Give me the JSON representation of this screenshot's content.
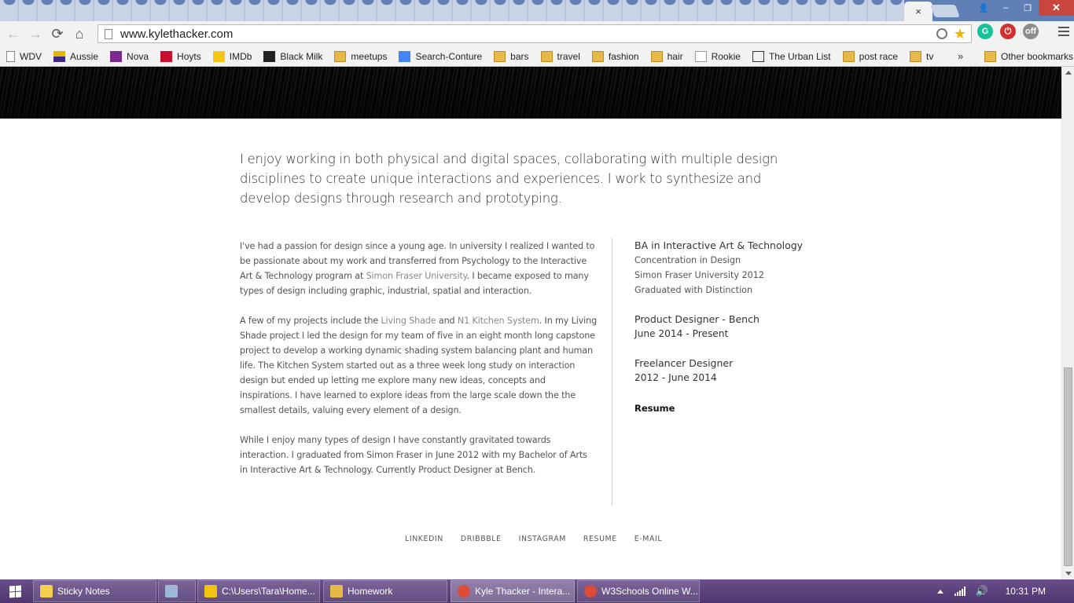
{
  "browser": {
    "active_tab_close": "×",
    "window_controls": {
      "user": "👤",
      "minimize": "–",
      "restore": "❐",
      "close": "✕"
    },
    "nav": {
      "back": "←",
      "forward": "→",
      "reload": "⟳",
      "home": "⌂"
    },
    "url": "www.kylethacker.com",
    "star": "★",
    "extensions": [
      {
        "name": "grammarly-icon",
        "label": "G",
        "color": "#15c39a"
      },
      {
        "name": "power-icon",
        "label": "⏻",
        "color": "#d32f2f"
      },
      {
        "name": "cat-extension-icon",
        "label": "off",
        "color": "#8c8c8c"
      }
    ]
  },
  "bookmarks": {
    "items": [
      {
        "label": "WDV",
        "icon": "doc"
      },
      {
        "label": "Aussie",
        "icon": "aussie"
      },
      {
        "label": "Nova",
        "icon": "nova"
      },
      {
        "label": "Hoyts",
        "icon": "hoyts"
      },
      {
        "label": "IMDb",
        "icon": "imdb"
      },
      {
        "label": "Black Milk",
        "icon": "bm"
      },
      {
        "label": "meetups",
        "icon": "folder"
      },
      {
        "label": "Search-Conture",
        "icon": "google"
      },
      {
        "label": "bars",
        "icon": "folder"
      },
      {
        "label": "travel",
        "icon": "folder"
      },
      {
        "label": "fashion",
        "icon": "folder"
      },
      {
        "label": "hair",
        "icon": "folder"
      },
      {
        "label": "Rookie",
        "icon": "rookie"
      },
      {
        "label": "The Urban List",
        "icon": "urban"
      },
      {
        "label": "post race",
        "icon": "folder"
      },
      {
        "label": "tv",
        "icon": "folder"
      }
    ],
    "overflow": "»",
    "other": "Other bookmarks"
  },
  "page": {
    "intro": "I enjoy working in both physical and digital spaces, collaborating with multiple design disciplines to create unique interactions and experiences. I work to synthesize and develop designs through research and prototyping.",
    "bio": {
      "p1_a": "I've had a passion for design since a young age. In university I realized I wanted to be passionate about my work and transferred from Psychology to the Interactive Art & Technology program at ",
      "p1_link": "Simon Fraser University",
      "p1_b": ". I became exposed to many types of design including graphic, industrial, spatial and interaction.",
      "p2_a": "A few of my projects include the ",
      "p2_link1": "Living Shade",
      "p2_and": " and ",
      "p2_link2": "N1 Kitchen System",
      "p2_b": ". In my Living Shade project I led the design for my team of five in an eight month long capstone project to develop a working dynamic shading system balancing plant and human life. The Kitchen System started out as a three week long study on interaction design but ended up letting me explore many new ideas, concepts and inspirations. I have learned to explore ideas from the large scale down the the smallest details, valuing every element of a design.",
      "p3": "While I enjoy many types of design I have constantly gravitated towards interaction. I graduated from Simon Fraser in June 2012 with my Bachelor of Arts in Interactive Art & Technology. Currently Product Designer at Bench."
    },
    "cv": {
      "degree_title": "BA in Interactive Art & Technology",
      "degree_lines": [
        "Concentration in Design",
        "Simon Fraser University 2012",
        "Graduated with Distinction"
      ],
      "job1_title": "Product Designer - Bench",
      "job1_dates": "June 2014 - Present",
      "job2_title": "Freelancer Designer",
      "job2_dates": "2012 - June 2014",
      "resume": "Resume"
    },
    "footer_links": [
      "LINKEDIN",
      "DRIBBBLE",
      "INSTAGRAM",
      "RESUME",
      "E-MAIL"
    ]
  },
  "taskbar": {
    "items": [
      {
        "label": "Sticky Notes",
        "color": "#f5d04c"
      },
      {
        "label": "",
        "color": "#9fb7d6"
      },
      {
        "label": "C:\\Users\\Tara\\Home...",
        "color": "#f1c40f"
      },
      {
        "label": "Homework",
        "color": "#e6b94a"
      },
      {
        "label": "Kyle Thacker - Intera...",
        "color": "#dd4b39",
        "active": true
      },
      {
        "label": "W3Schools Online W...",
        "color": "#dd4b39"
      }
    ],
    "clock": "10:31 PM"
  }
}
